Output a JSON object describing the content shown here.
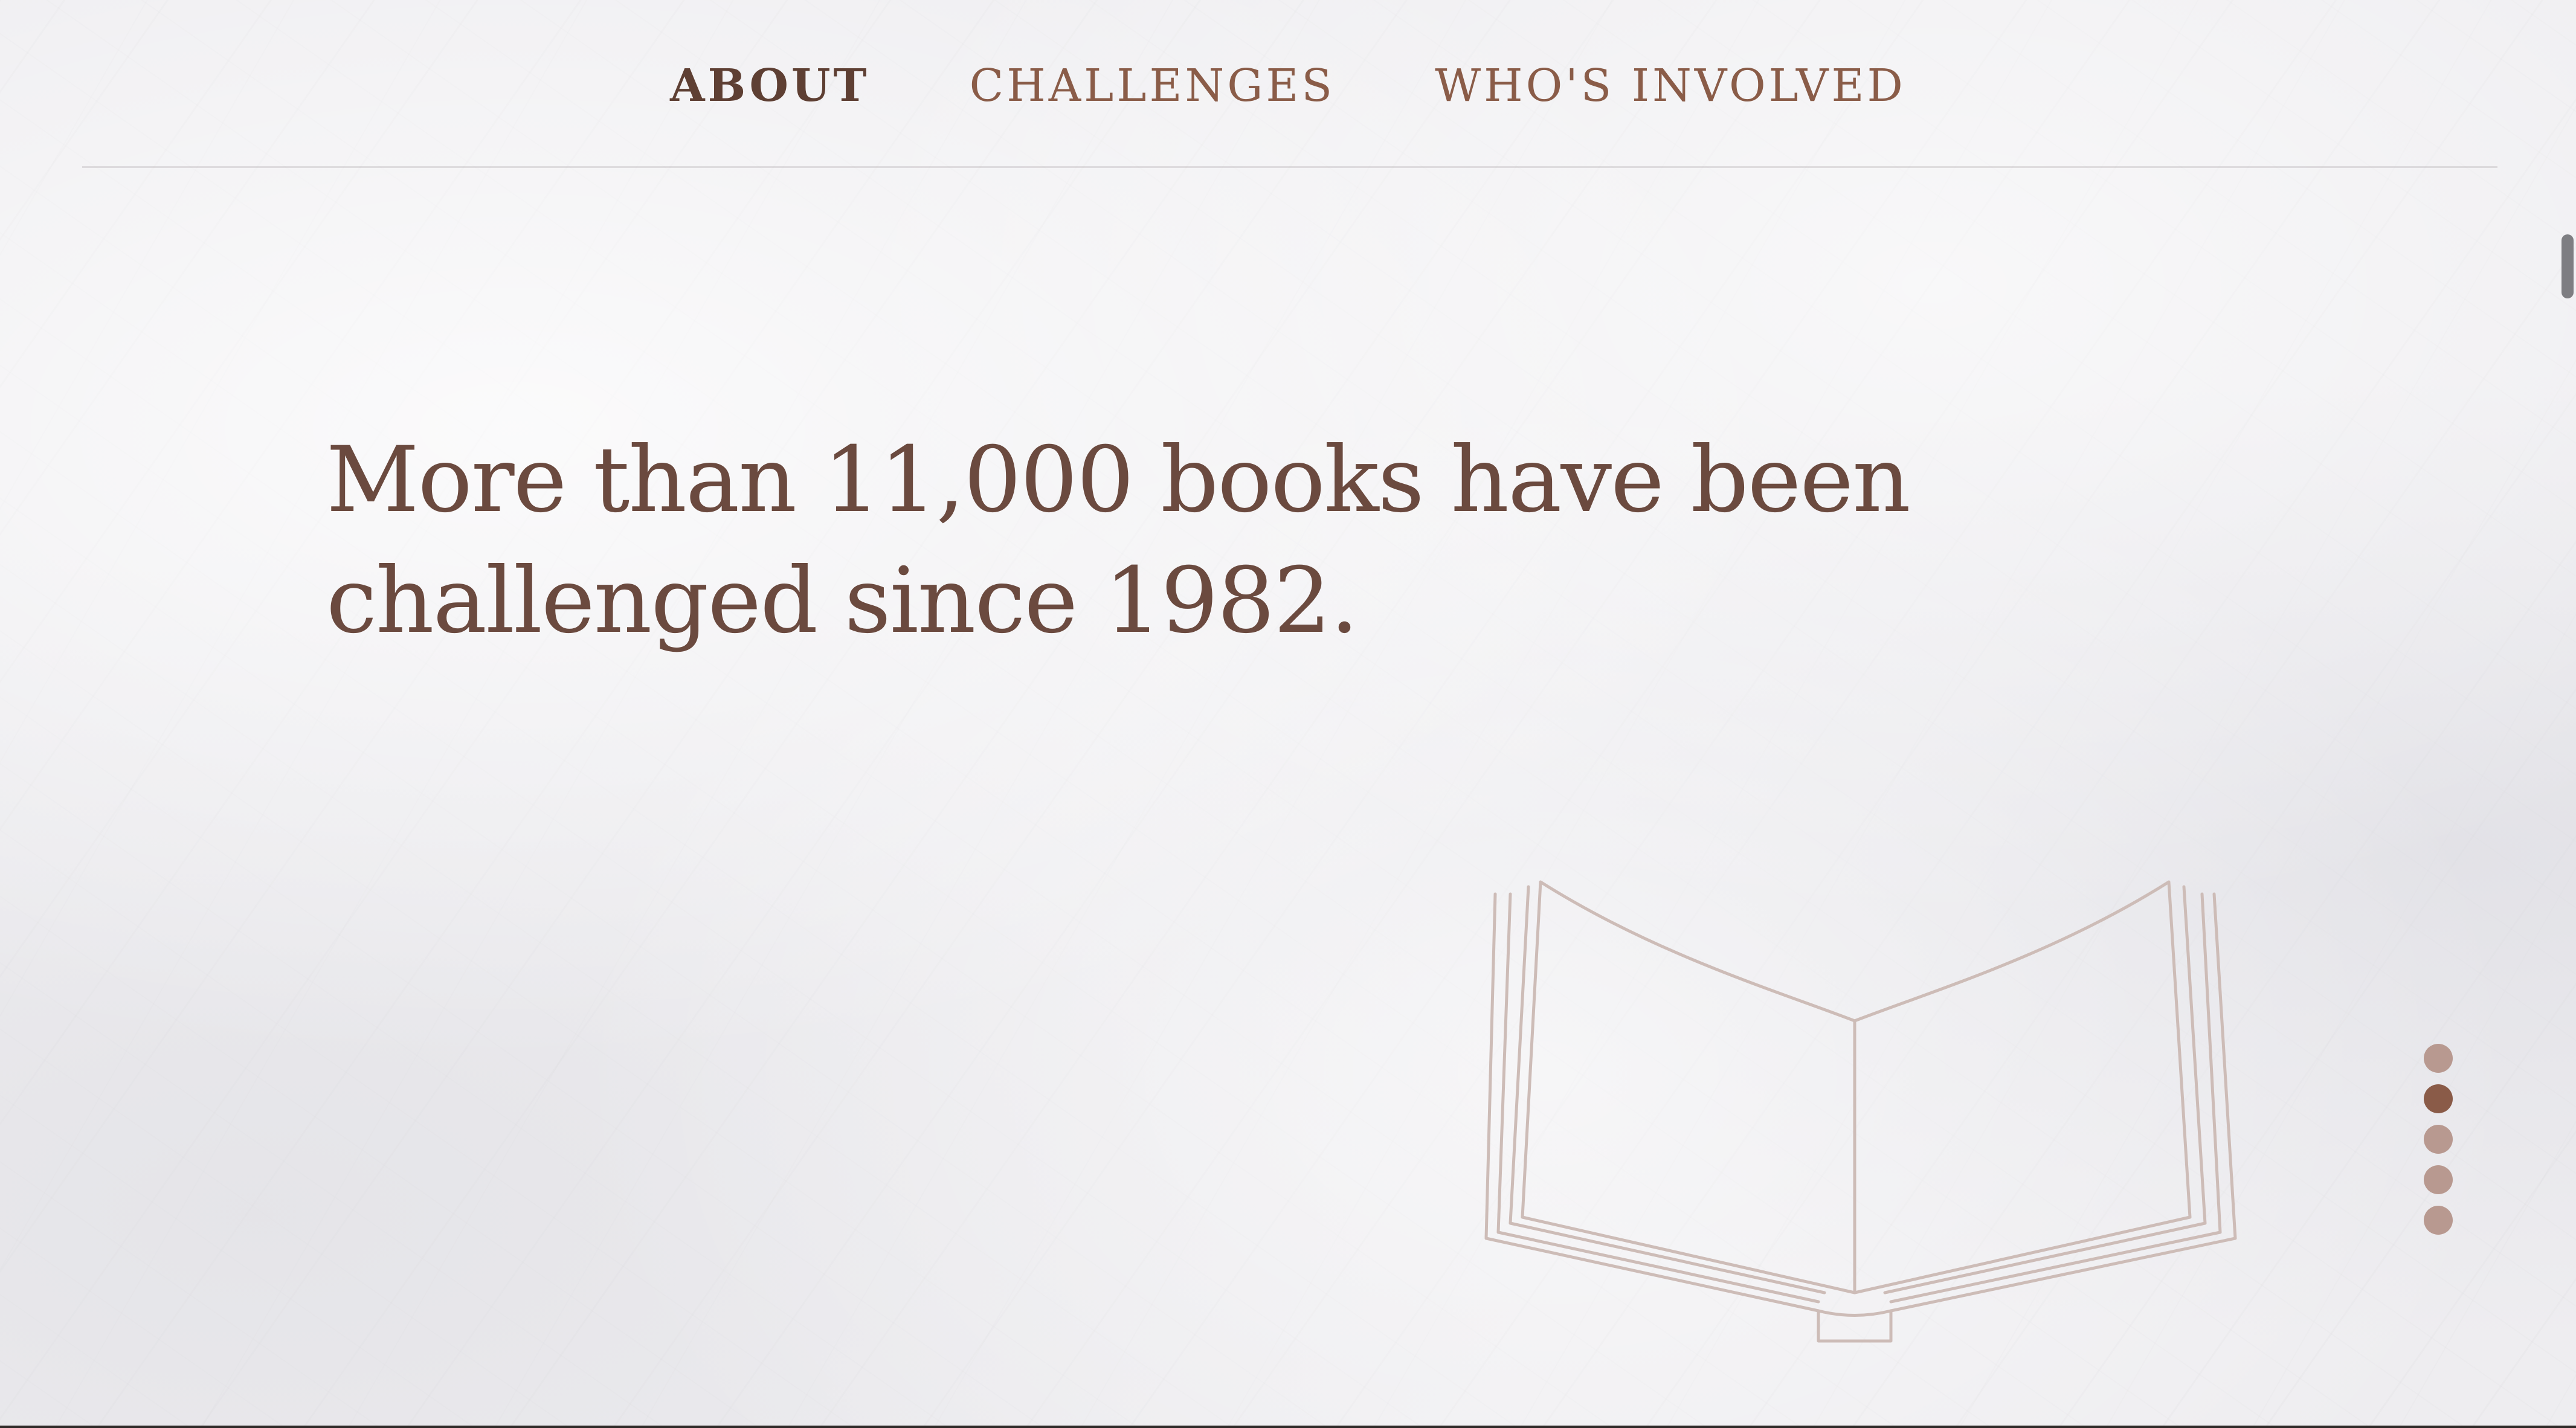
{
  "nav": {
    "items": [
      {
        "label": "ABOUT",
        "active": true
      },
      {
        "label": "CHALLENGES",
        "active": false
      },
      {
        "label": "WHO'S INVOLVED",
        "active": false
      }
    ]
  },
  "hero": {
    "headline_line1": "More than 11,000 books have been",
    "headline_line2": "challenged since 1982."
  },
  "illustration": {
    "icon": "open-book-icon",
    "stroke_color": "#cdbcb7"
  },
  "pagination": {
    "total": 5,
    "active_index": 1
  },
  "colors": {
    "text_primary": "#6b4a3f",
    "nav_active": "#5e3f33",
    "nav_inactive": "#8a5c48",
    "dot_active": "#8a5b48",
    "dot_inactive": "#b89990"
  }
}
